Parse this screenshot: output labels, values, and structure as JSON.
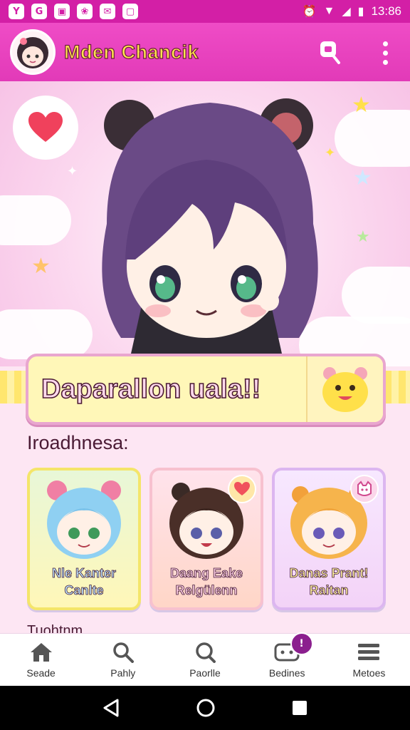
{
  "status_bar": {
    "left_icons": [
      "Y",
      "G",
      "▣",
      "❀",
      "✉",
      "▢"
    ],
    "time": "13:86"
  },
  "app_bar": {
    "title": "Mden Chancik",
    "title_color": "#ffe44d",
    "bar_color": "#e23ab8"
  },
  "banner": {
    "text": "Daparallon uala!!"
  },
  "section": {
    "title": "Iroadhnesa:"
  },
  "cards": [
    {
      "line1": "Nle Kanter",
      "line2": "Canlte"
    },
    {
      "line1": "Daang Eake",
      "line2": "Relgülenn"
    },
    {
      "line1": "Danas Prant!",
      "line2": "Raitan"
    }
  ],
  "peek_text": "Tuohtnm",
  "bottom_nav": [
    {
      "label": "Seade",
      "icon": "home-icon"
    },
    {
      "label": "Pahly",
      "icon": "search-icon"
    },
    {
      "label": "Paorlle",
      "icon": "profile-search-icon"
    },
    {
      "label": "Bedines",
      "icon": "chat-icon",
      "badge": "!"
    },
    {
      "label": "Metoes",
      "icon": "menu-list-icon"
    }
  ],
  "colors": {
    "accent": "#e23ab8",
    "status": "#d31fa6",
    "banner_bg": "#fff7b8"
  }
}
